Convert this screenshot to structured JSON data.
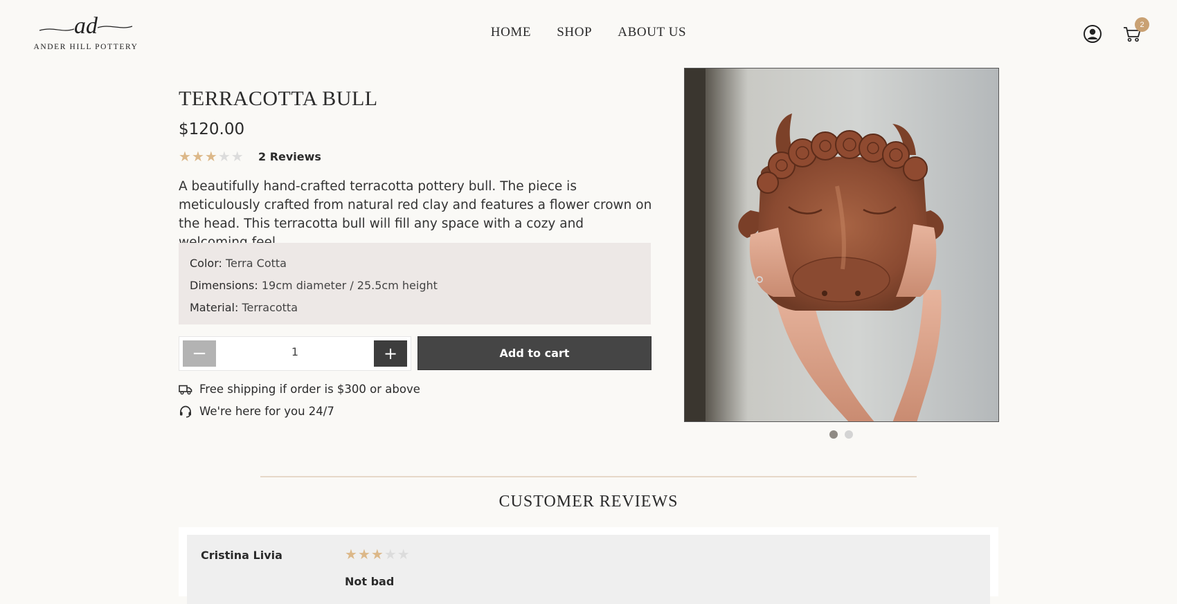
{
  "brand": {
    "monogram": "ad",
    "name": "ANDER HILL POTTERY"
  },
  "nav": {
    "items": [
      "HOME",
      "SHOP",
      "ABOUT US"
    ]
  },
  "header": {
    "account_icon": "user-circle-icon",
    "cart_icon": "shopping-cart-icon",
    "cart_count": "2"
  },
  "product": {
    "title": "TERRACOTTA BULL",
    "price": "$120.00",
    "rating": 3,
    "rating_max": 5,
    "review_count_label": "2 Reviews",
    "description": "A beautifully hand-crafted terracotta pottery bull. The piece is meticulously crafted from natural red clay and features a flower crown on the head. This terracotta bull will fill any space with a cozy and welcoming feel.",
    "specs": [
      {
        "label": "Color:",
        "value": "Terra Cotta"
      },
      {
        "label": "Dimensions:",
        "value": "19cm diameter / 25.5cm height"
      },
      {
        "label": "Material:",
        "value": "Terracotta"
      }
    ],
    "quantity": "1",
    "minus_label": "−",
    "plus_label": "+",
    "add_to_cart_label": "Add to cart",
    "perks": [
      {
        "icon": "truck-icon",
        "text": "Free shipping if order is $300 or above"
      },
      {
        "icon": "headset-icon",
        "text": "We're here for you 24/7"
      }
    ],
    "gallery": {
      "count": 2,
      "active_index": 0
    }
  },
  "colors": {
    "accent": "#c9a173",
    "star_on": "#dcb889",
    "star_off": "#dcdcdc",
    "button_dark": "#454545"
  },
  "reviews": {
    "heading": "CUSTOMER REVIEWS",
    "items": [
      {
        "author": "Cristina Livia",
        "rating": 3,
        "title": "Not bad"
      }
    ]
  }
}
